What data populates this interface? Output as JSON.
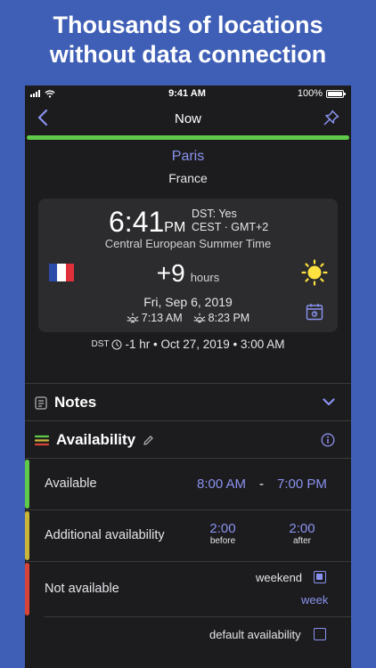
{
  "headline": {
    "line1": "Thousands of locations",
    "line2": "without data connection"
  },
  "status_bar": {
    "time": "9:41 AM",
    "battery": "100%"
  },
  "nav": {
    "title": "Now"
  },
  "location": {
    "city": "Paris",
    "country": "France"
  },
  "clock": {
    "time": "6:41",
    "ampm": "PM",
    "dst": "DST: Yes",
    "tz_short": "CEST · GMT+2",
    "tz_name": "Central European Summer Time",
    "offset": "+9",
    "offset_unit": "hours",
    "date": "Fri, Sep 6, 2019",
    "sunrise": "7:13 AM",
    "sunset": "8:23 PM"
  },
  "dst_change": {
    "prefix": "DST",
    "text": "-1 hr • Oct 27, 2019 • 3:00 AM"
  },
  "notes": {
    "title": "Notes"
  },
  "availability": {
    "title": "Availability",
    "available": {
      "label": "Available",
      "from": "8:00 AM",
      "separator": "-",
      "to": "7:00 PM"
    },
    "additional": {
      "label": "Additional availability",
      "before_time": "2:00",
      "before_label": "before",
      "after_time": "2:00",
      "after_label": "after"
    },
    "not_available": {
      "label": "Not available",
      "weekend_label": "weekend",
      "week_label": "week"
    },
    "default_label": "default availability"
  },
  "colors": {
    "accent": "#8a92ee",
    "green": "#5fc94a",
    "yellow": "#c9b53a",
    "red": "#d9443a",
    "background": "#3f5fb6"
  }
}
